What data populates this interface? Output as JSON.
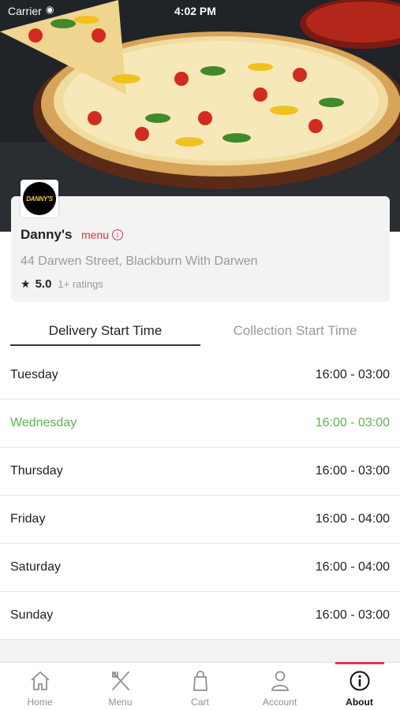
{
  "status_bar": {
    "carrier": "Carrier",
    "time": "4:02 PM"
  },
  "restaurant": {
    "logo_text": "DANNY'S",
    "name": "Danny's",
    "menu_label": "menu",
    "address": "44 Darwen Street, Blackburn With Darwen",
    "rating": "5.0",
    "rating_count": "1+ ratings"
  },
  "tabs": [
    {
      "label": "Delivery Start Time",
      "active": true
    },
    {
      "label": "Collection Start Time",
      "active": false
    }
  ],
  "schedule": [
    {
      "day": "Tuesday",
      "hours": "16:00 - 03:00",
      "highlight": false
    },
    {
      "day": "Wednesday",
      "hours": "16:00 - 03:00",
      "highlight": true
    },
    {
      "day": "Thursday",
      "hours": "16:00 - 03:00",
      "highlight": false
    },
    {
      "day": "Friday",
      "hours": "16:00 - 04:00",
      "highlight": false
    },
    {
      "day": "Saturday",
      "hours": "16:00 - 04:00",
      "highlight": false
    },
    {
      "day": "Sunday",
      "hours": "16:00 - 03:00",
      "highlight": false
    }
  ],
  "bottom_nav": [
    {
      "label": "Home",
      "icon": "home-icon",
      "active": false
    },
    {
      "label": "Menu",
      "icon": "utensils-icon",
      "active": false
    },
    {
      "label": "Cart",
      "icon": "shopping-bag-icon",
      "active": false
    },
    {
      "label": "Account",
      "icon": "user-icon",
      "active": false
    },
    {
      "label": "About",
      "icon": "info-icon",
      "active": true
    }
  ],
  "colors": {
    "accent": "#e2364b",
    "highlight": "#5db550",
    "tab_indicator": "#2f3542",
    "muted": "#9a9a9a"
  }
}
